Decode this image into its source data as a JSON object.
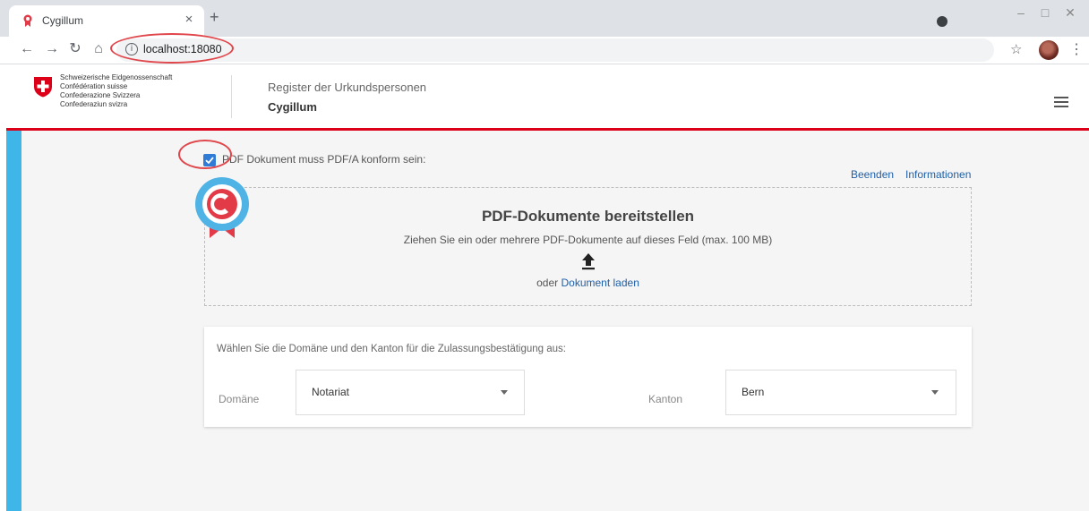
{
  "browser": {
    "tab_title": "Cygillum",
    "tab_close": "×",
    "new_tab": "+",
    "url": "localhost:18080",
    "info_glyph": "i",
    "icons": [
      "cygillum-favicon-icon",
      "back-arrow-icon",
      "forward-arrow-icon",
      "reload-icon",
      "home-icon",
      "info-icon",
      "star-icon",
      "avatar",
      "kebab-menu-icon"
    ]
  },
  "header": {
    "coat_lines": [
      "Schweizerische Eidgenossenschaft",
      "Confédération suisse",
      "Confederazione Svizzera",
      "Confederaziun svizra"
    ],
    "subtitle": "Register der Urkundspersonen",
    "title": "Cygillum"
  },
  "main": {
    "pdfa_checkbox_label": "PDF Dokument muss PDF/A konform sein:",
    "pdfa_checked": true,
    "links": {
      "quit": "Beenden",
      "info": "Informationen"
    },
    "dropzone": {
      "title": "PDF-Dokumente bereitstellen",
      "hint": "Ziehen Sie ein oder mehrere PDF-Dokumente auf dieses Feld (max. 100 MB)",
      "or_text": "oder",
      "load_link": "Dokument laden"
    },
    "selection": {
      "prompt": "Wählen Sie die Domäne und den Kanton für die Zulassungsbestätigung aus:",
      "domain_label": "Domäne",
      "domain_value": "Notariat",
      "canton_label": "Kanton",
      "canton_value": "Bern"
    }
  },
  "colors": {
    "swiss_red": "#dc0018",
    "accent_blue": "#3fb6e8",
    "link_blue": "#1f5fa8",
    "annotation_red": "#e0474c",
    "badge_blue": "#4fb3e6",
    "badge_red": "#e23a47"
  }
}
